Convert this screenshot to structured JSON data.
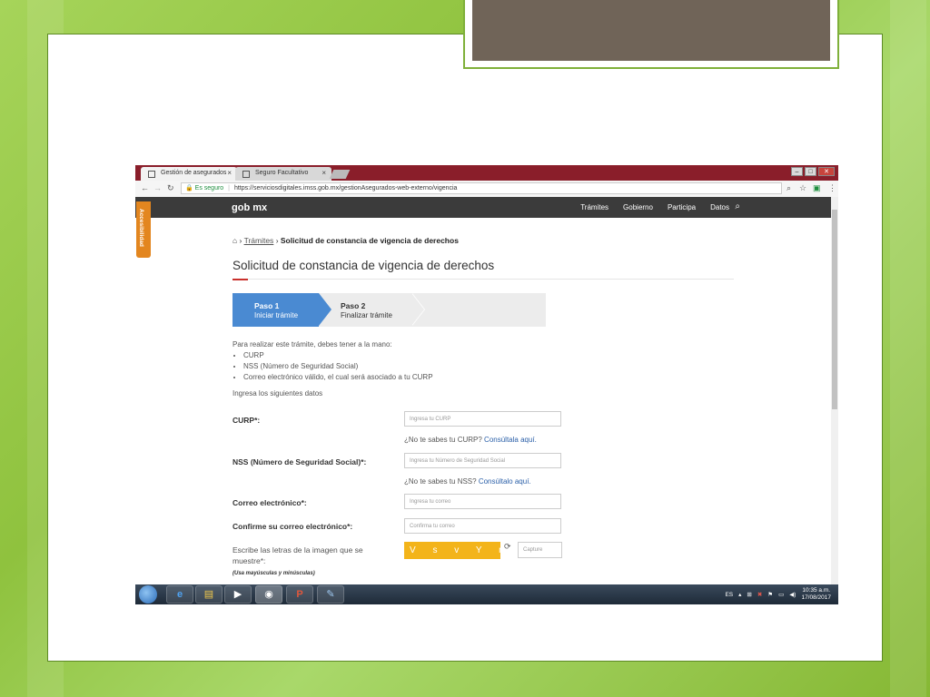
{
  "browser": {
    "tabs": [
      {
        "label": "Gestión de asegurados",
        "close": "×"
      },
      {
        "label": "Seguro Facultativo",
        "close": "×"
      }
    ],
    "window_controls": {
      "minimize": "–",
      "maximize": "□",
      "close": "✕"
    },
    "address": {
      "secure_label": "Es seguro",
      "url": "https://serviciosdigitales.imss.gob.mx/gestionAsegurados-web-externo/vigencia"
    }
  },
  "header": {
    "logo": "gob mx",
    "nav": [
      "Trámites",
      "Gobierno",
      "Participa",
      "Datos"
    ],
    "accessibility_tab": "Accesibilidad"
  },
  "breadcrumb": {
    "link": "Trámites",
    "current": "Solicitud de constancia de vigencia de derechos"
  },
  "page_title": "Solicitud de constancia de vigencia de derechos",
  "steps": [
    {
      "title": "Paso 1",
      "subtitle": "Iniciar trámite",
      "active": true
    },
    {
      "title": "Paso 2",
      "subtitle": "Finalizar trámite",
      "active": false
    }
  ],
  "intro": {
    "text": "Para realizar este trámite, debes tener a la mano:",
    "items": [
      "CURP",
      "NSS (Número de Seguridad Social)",
      "Correo electrónico válido, el cual será asociado a tu CURP"
    ],
    "prompt": "Ingresa los siguientes datos"
  },
  "form": {
    "curp": {
      "label": "CURP*:",
      "placeholder": "Ingresa tu CURP",
      "help": "¿No te sabes tu CURP?",
      "help_link": "Consúltala aquí."
    },
    "nss": {
      "label": "NSS (Número de Seguridad Social)*:",
      "placeholder": "Ingresa tu Número de Seguridad Social",
      "help": "¿No te sabes tu NSS?",
      "help_link": "Consúltalo aquí."
    },
    "email": {
      "label": "Correo electrónico*:",
      "placeholder": "Ingresa tu correo"
    },
    "email_confirm": {
      "label": "Confirme su correo electrónico*:",
      "placeholder": "Confirma tu correo"
    },
    "captcha": {
      "label": "Escribe las letras de la imagen que se muestre*:",
      "note": "(Usa mayúsculas y minúsculas)",
      "image_text": "V s v Y m",
      "placeholder": "Capture"
    }
  },
  "taskbar": {
    "language": "ES",
    "time": "10:35 a.m.",
    "date": "17/08/2017"
  },
  "colors": {
    "slide_bg": "#9bcc4c",
    "top_box": "#706458",
    "tab_bar": "#8a1e2a",
    "gob_header": "#3b3b3b",
    "step_active": "#4a8ad2",
    "accent": "#c9302c",
    "captcha_bg": "#f3b41a",
    "access_tab": "#e3861f"
  }
}
